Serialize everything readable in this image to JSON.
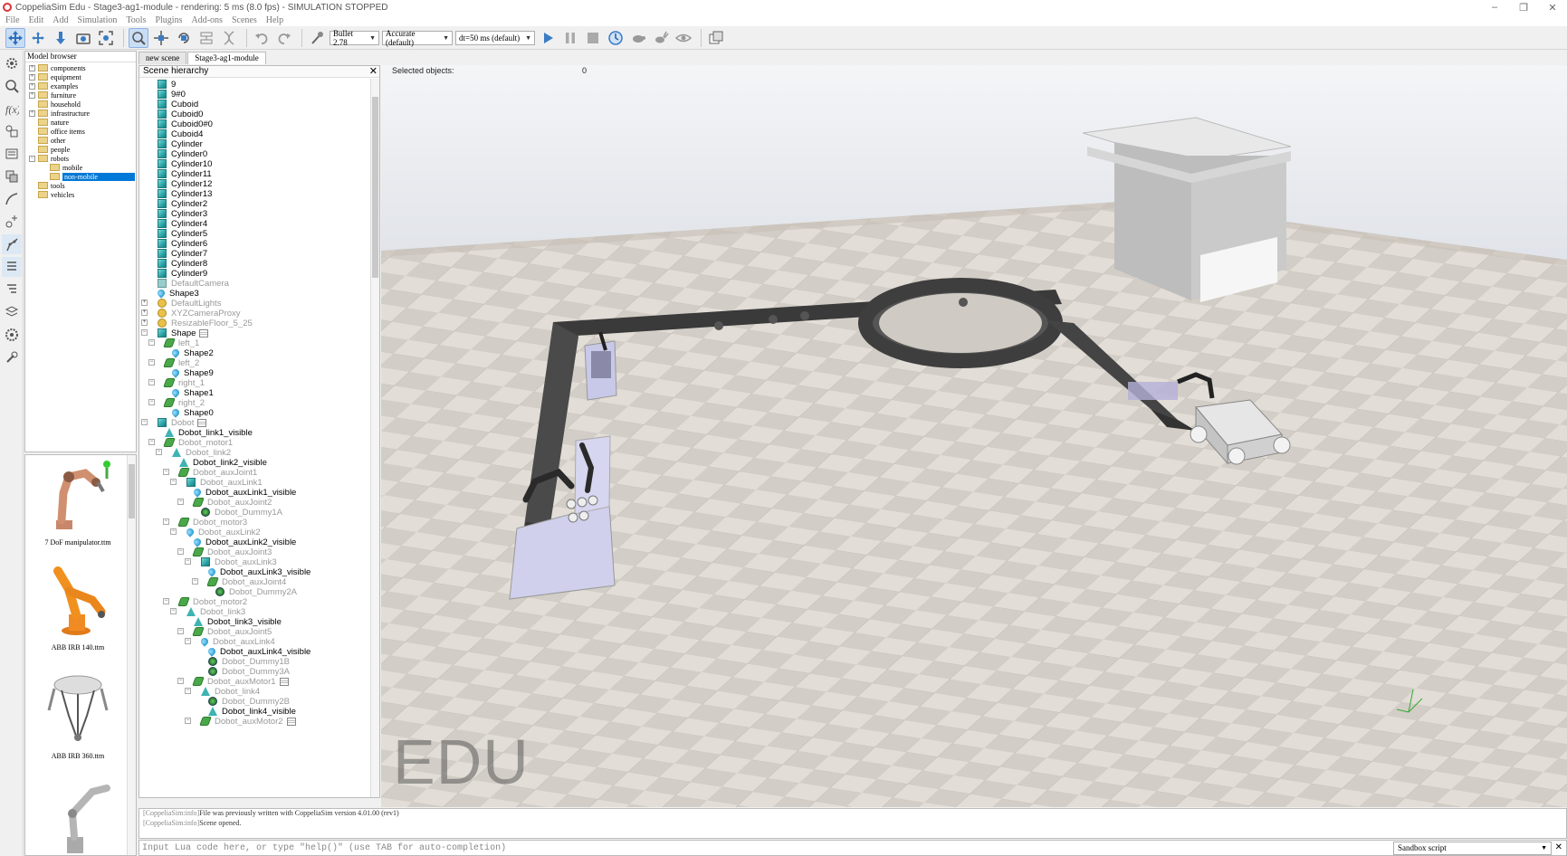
{
  "window": {
    "title": "CoppeliaSim Edu - Stage3-ag1-module - rendering: 5 ms (8.0 fps) - SIMULATION STOPPED",
    "controls": [
      "–",
      "❐",
      "✕"
    ]
  },
  "menu": [
    "File",
    "Edit",
    "Add",
    "Simulation",
    "Tools",
    "Plugins",
    "Add-ons",
    "Scenes",
    "Help"
  ],
  "toolbar": {
    "physics_engine": "Bullet 2.78",
    "accuracy": "Accurate (default)",
    "timestep": "dt=50 ms (default)"
  },
  "model_browser": {
    "title": "Model browser",
    "items": [
      {
        "label": "components",
        "exp": "+"
      },
      {
        "label": "equipment",
        "exp": "+"
      },
      {
        "label": "examples",
        "exp": "+"
      },
      {
        "label": "furniture",
        "exp": "+"
      },
      {
        "label": "household",
        "exp": ""
      },
      {
        "label": "infrastructure",
        "exp": "+"
      },
      {
        "label": "nature",
        "exp": ""
      },
      {
        "label": "office items",
        "exp": ""
      },
      {
        "label": "other",
        "exp": ""
      },
      {
        "label": "people",
        "exp": ""
      },
      {
        "label": "robots",
        "exp": "−"
      },
      {
        "label": "mobile",
        "exp": ""
      },
      {
        "label": "non-mobile",
        "exp": ""
      },
      {
        "label": "tools",
        "exp": ""
      },
      {
        "label": "vehicles",
        "exp": ""
      }
    ],
    "thumbnails": [
      "7 DoF manipulator.ttm",
      "ABB IRB 140.ttm",
      "ABB IRB 360.ttm",
      ""
    ]
  },
  "tabs": [
    "new scene",
    "Stage3-ag1-module"
  ],
  "hierarchy": {
    "title": "Scene hierarchy",
    "close": "✕",
    "rows": [
      {
        "label": "9",
        "icon": "cube",
        "x": 10,
        "dim": false
      },
      {
        "label": "9#0",
        "icon": "cube",
        "x": 10,
        "dim": false
      },
      {
        "label": "Cuboid",
        "icon": "cube",
        "x": 10,
        "dim": false
      },
      {
        "label": "Cuboid0",
        "icon": "cube",
        "x": 10,
        "dim": false
      },
      {
        "label": "Cuboid0#0",
        "icon": "cube",
        "x": 10,
        "dim": false
      },
      {
        "label": "Cuboid4",
        "icon": "cube",
        "x": 10,
        "dim": false
      },
      {
        "label": "Cylinder",
        "icon": "cube",
        "x": 10,
        "dim": false
      },
      {
        "label": "Cylinder0",
        "icon": "cube",
        "x": 10,
        "dim": false
      },
      {
        "label": "Cylinder10",
        "icon": "cube",
        "x": 10,
        "dim": false
      },
      {
        "label": "Cylinder11",
        "icon": "cube",
        "x": 10,
        "dim": false
      },
      {
        "label": "Cylinder12",
        "icon": "cube",
        "x": 10,
        "dim": false
      },
      {
        "label": "Cylinder13",
        "icon": "cube",
        "x": 10,
        "dim": false
      },
      {
        "label": "Cylinder2",
        "icon": "cube",
        "x": 10,
        "dim": false
      },
      {
        "label": "Cylinder3",
        "icon": "cube",
        "x": 10,
        "dim": false
      },
      {
        "label": "Cylinder4",
        "icon": "cube",
        "x": 10,
        "dim": false
      },
      {
        "label": "Cylinder5",
        "icon": "cube",
        "x": 10,
        "dim": false
      },
      {
        "label": "Cylinder6",
        "icon": "cube",
        "x": 10,
        "dim": false
      },
      {
        "label": "Cylinder7",
        "icon": "cube",
        "x": 10,
        "dim": false
      },
      {
        "label": "Cylinder8",
        "icon": "cube",
        "x": 10,
        "dim": false
      },
      {
        "label": "Cylinder9",
        "icon": "cube",
        "x": 10,
        "dim": false
      },
      {
        "label": "DefaultCamera",
        "icon": "cam",
        "x": 10,
        "dim": true
      },
      {
        "label": "Shape3",
        "icon": "drop",
        "x": 10,
        "dim": false
      },
      {
        "label": "DefaultLights",
        "icon": "light",
        "x": 10,
        "dim": true,
        "exp": "+"
      },
      {
        "label": "XYZCameraProxy",
        "icon": "light",
        "x": 10,
        "dim": true,
        "exp": "+"
      },
      {
        "label": "ResizableFloor_5_25",
        "icon": "light",
        "x": 10,
        "dim": true,
        "exp": "+"
      },
      {
        "label": "Shape",
        "icon": "cube",
        "x": 10,
        "dim": false,
        "exp": "−",
        "script": true
      },
      {
        "label": "left_1",
        "icon": "joint",
        "x": 18,
        "dim": true,
        "exp": "−"
      },
      {
        "label": "Shape2",
        "icon": "drop",
        "x": 26,
        "dim": false
      },
      {
        "label": "left_2",
        "icon": "joint",
        "x": 18,
        "dim": true,
        "exp": "−"
      },
      {
        "label": "Shape9",
        "icon": "drop",
        "x": 26,
        "dim": false
      },
      {
        "label": "right_1",
        "icon": "joint",
        "x": 18,
        "dim": true,
        "exp": "−"
      },
      {
        "label": "Shape1",
        "icon": "drop",
        "x": 26,
        "dim": false
      },
      {
        "label": "right_2",
        "icon": "joint",
        "x": 18,
        "dim": true,
        "exp": "−"
      },
      {
        "label": "Shape0",
        "icon": "drop",
        "x": 26,
        "dim": false
      },
      {
        "label": "Dobot",
        "icon": "cube",
        "x": 10,
        "dim": true,
        "exp": "−",
        "script": true
      },
      {
        "label": "Dobot_link1_visible",
        "icon": "mesh",
        "x": 18,
        "dim": false
      },
      {
        "label": "Dobot_motor1",
        "icon": "joint",
        "x": 18,
        "dim": true,
        "exp": "−"
      },
      {
        "label": "Dobot_link2",
        "icon": "mesh",
        "x": 26,
        "dim": true,
        "exp": "−"
      },
      {
        "label": "Dobot_link2_visible",
        "icon": "mesh",
        "x": 34,
        "dim": false
      },
      {
        "label": "Dobot_auxJoint1",
        "icon": "joint",
        "x": 34,
        "dim": true,
        "exp": "−"
      },
      {
        "label": "Dobot_auxLink1",
        "icon": "cube",
        "x": 42,
        "dim": true,
        "exp": "−"
      },
      {
        "label": "Dobot_auxLink1_visible",
        "icon": "drop",
        "x": 50,
        "dim": false
      },
      {
        "label": "Dobot_auxJoint2",
        "icon": "joint",
        "x": 50,
        "dim": true,
        "exp": "−"
      },
      {
        "label": "Dobot_Dummy1A",
        "icon": "dummy",
        "x": 58,
        "dim": true
      },
      {
        "label": "Dobot_motor3",
        "icon": "joint",
        "x": 34,
        "dim": true,
        "exp": "−"
      },
      {
        "label": "Dobot_auxLink2",
        "icon": "drop",
        "x": 42,
        "dim": true,
        "exp": "−"
      },
      {
        "label": "Dobot_auxLink2_visible",
        "icon": "drop",
        "x": 50,
        "dim": false
      },
      {
        "label": "Dobot_auxJoint3",
        "icon": "joint",
        "x": 50,
        "dim": true,
        "exp": "−"
      },
      {
        "label": "Dobot_auxLink3",
        "icon": "cube",
        "x": 58,
        "dim": true,
        "exp": "−"
      },
      {
        "label": "Dobot_auxLink3_visible",
        "icon": "drop",
        "x": 66,
        "dim": false
      },
      {
        "label": "Dobot_auxJoint4",
        "icon": "joint",
        "x": 66,
        "dim": true,
        "exp": "−"
      },
      {
        "label": "Dobot_Dummy2A",
        "icon": "dummy",
        "x": 74,
        "dim": true
      },
      {
        "label": "Dobot_motor2",
        "icon": "joint",
        "x": 34,
        "dim": true,
        "exp": "−"
      },
      {
        "label": "Dobot_link3",
        "icon": "mesh",
        "x": 42,
        "dim": true,
        "exp": "−"
      },
      {
        "label": "Dobot_link3_visible",
        "icon": "mesh",
        "x": 50,
        "dim": false
      },
      {
        "label": "Dobot_auxJoint5",
        "icon": "joint",
        "x": 50,
        "dim": true,
        "exp": "−"
      },
      {
        "label": "Dobot_auxLink4",
        "icon": "drop",
        "x": 58,
        "dim": true,
        "exp": "−"
      },
      {
        "label": "Dobot_auxLink4_visible",
        "icon": "drop",
        "x": 66,
        "dim": false
      },
      {
        "label": "Dobot_Dummy1B",
        "icon": "dummy",
        "x": 66,
        "dim": true
      },
      {
        "label": "Dobot_Dummy3A",
        "icon": "dummy",
        "x": 66,
        "dim": true
      },
      {
        "label": "Dobot_auxMotor1",
        "icon": "joint",
        "x": 50,
        "dim": true,
        "exp": "−",
        "script": true
      },
      {
        "label": "Dobot_link4",
        "icon": "mesh",
        "x": 58,
        "dim": true,
        "exp": "−"
      },
      {
        "label": "Dobot_Dummy2B",
        "icon": "dummy",
        "x": 66,
        "dim": true
      },
      {
        "label": "Dobot_link4_visible",
        "icon": "mesh",
        "x": 66,
        "dim": false
      },
      {
        "label": "Dobot_auxMotor2",
        "icon": "joint",
        "x": 58,
        "dim": true,
        "exp": "−",
        "script": true
      }
    ]
  },
  "viewport": {
    "selected_label": "Selected objects:",
    "selected_count": "0",
    "watermark": "EDU"
  },
  "console": {
    "lines": [
      {
        "prefix": "[CoppeliaSim:info]",
        "text": "File was previously written with CoppeliaSim version 4.01.00 (rev1)"
      },
      {
        "prefix": "[CoppeliaSim:info]",
        "text": "Scene opened."
      }
    ],
    "placeholder": "Input Lua code here, or type \"help()\" (use TAB for auto-completion)",
    "script_type": "Sandbox script"
  }
}
